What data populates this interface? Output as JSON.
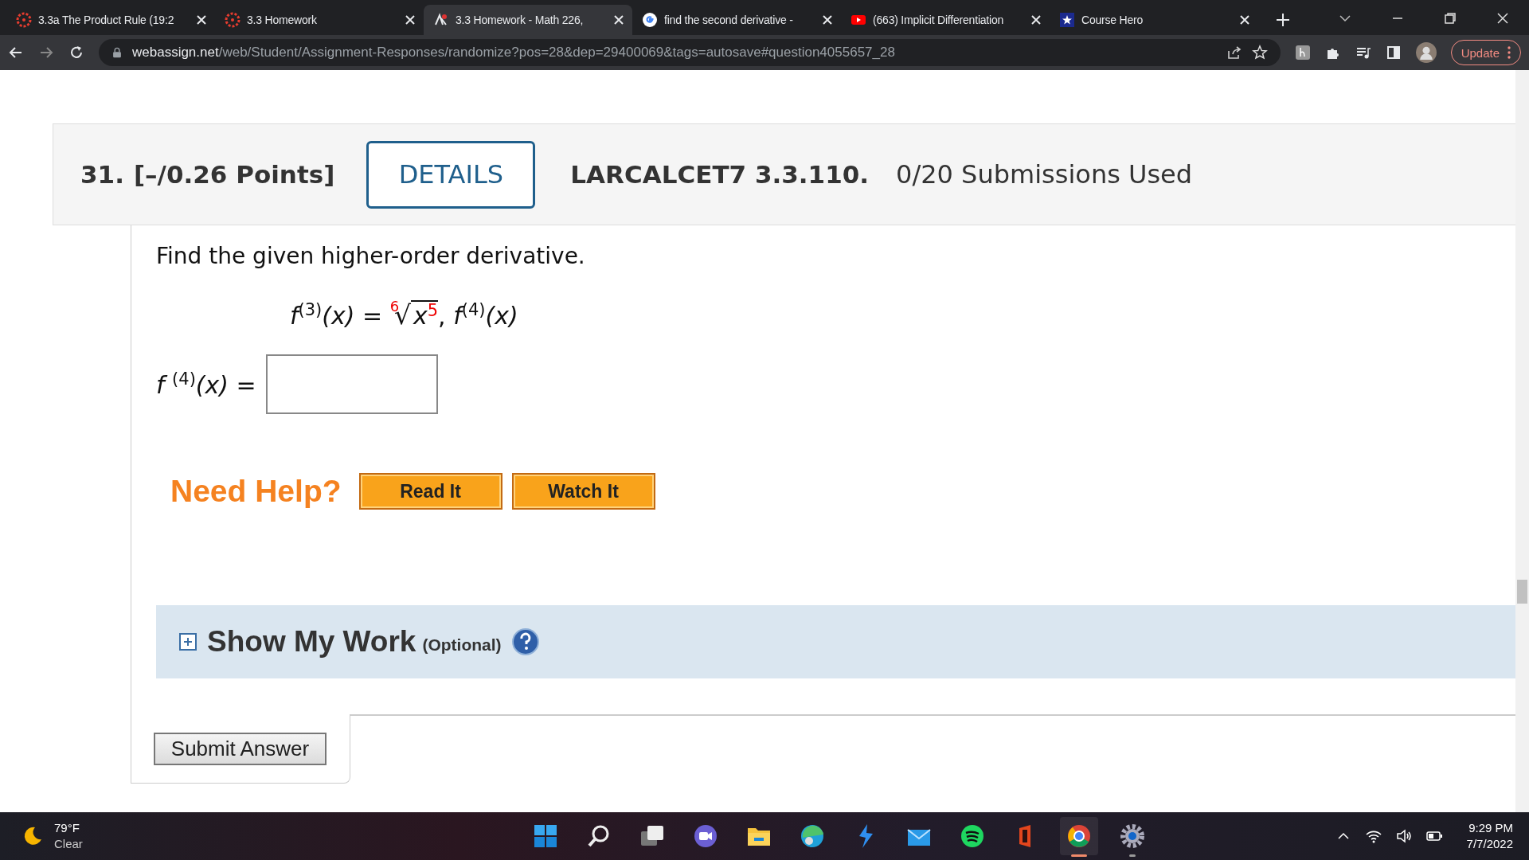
{
  "tabs": [
    {
      "kind": "canvas",
      "title": "3.3a The Product Rule (19:2",
      "selected": false
    },
    {
      "kind": "canvas",
      "title": "3.3 Homework",
      "selected": false
    },
    {
      "kind": "webassign",
      "title": "3.3 Homework - Math 226,",
      "selected": true
    },
    {
      "kind": "google",
      "title": "find the second derivative -",
      "selected": false
    },
    {
      "kind": "youtube",
      "title": "(663) Implicit Differentiation",
      "selected": false
    },
    {
      "kind": "coursehero",
      "title": "Course Hero",
      "selected": false
    }
  ],
  "address_bar": {
    "domain": "webassign.net",
    "path": "/web/Student/Assignment-Responses/randomize?pos=28&dep=29400069&tags=autosave#question4055657_28",
    "update_button": "Update"
  },
  "question": {
    "number": "31.",
    "points": "[–/0.26 Points]",
    "details_button": "DETAILS",
    "code": "LARCALCET7 3.3.110.",
    "submissions": "0/20 Submissions Used",
    "prompt": "Find the given higher-order derivative.",
    "formula": {
      "given_order": "(3)",
      "fn": "f",
      "arg": "(x)",
      "equals": "=",
      "radical": "√",
      "root_index": "6",
      "radicand": "x",
      "power": "5",
      "separator": ",",
      "target_fn": "f",
      "target_order": "(4)",
      "target_arg": "(x)"
    },
    "answer": {
      "fn": "f",
      "order": "(4)",
      "arg": "(x)",
      "equals": "="
    },
    "need_help": "Need Help?",
    "help_buttons": [
      "Read It",
      "Watch It"
    ],
    "show_my_work": {
      "title": "Show My Work",
      "note": "(Optional)",
      "expanded": false
    },
    "submit_button": "Submit Answer"
  },
  "taskbar": {
    "weather": {
      "temp": "79°F",
      "condition": "Clear"
    },
    "apps": [
      {
        "kind": "start",
        "running": false,
        "selected": false
      },
      {
        "kind": "search",
        "running": false,
        "selected": false
      },
      {
        "kind": "taskview",
        "running": false,
        "selected": false
      },
      {
        "kind": "chat",
        "running": false,
        "selected": false
      },
      {
        "kind": "explorer",
        "running": false,
        "selected": false
      },
      {
        "kind": "edge",
        "running": false,
        "selected": false
      },
      {
        "kind": "bolt",
        "running": false,
        "selected": false
      },
      {
        "kind": "mail",
        "running": false,
        "selected": false
      },
      {
        "kind": "spotify",
        "running": false,
        "selected": false
      },
      {
        "kind": "office",
        "running": false,
        "selected": false
      },
      {
        "kind": "chrome",
        "running": true,
        "selected": true
      },
      {
        "kind": "settings",
        "running": true,
        "selected": false
      }
    ],
    "time": "9:29 PM",
    "date": "7/7/2022"
  }
}
